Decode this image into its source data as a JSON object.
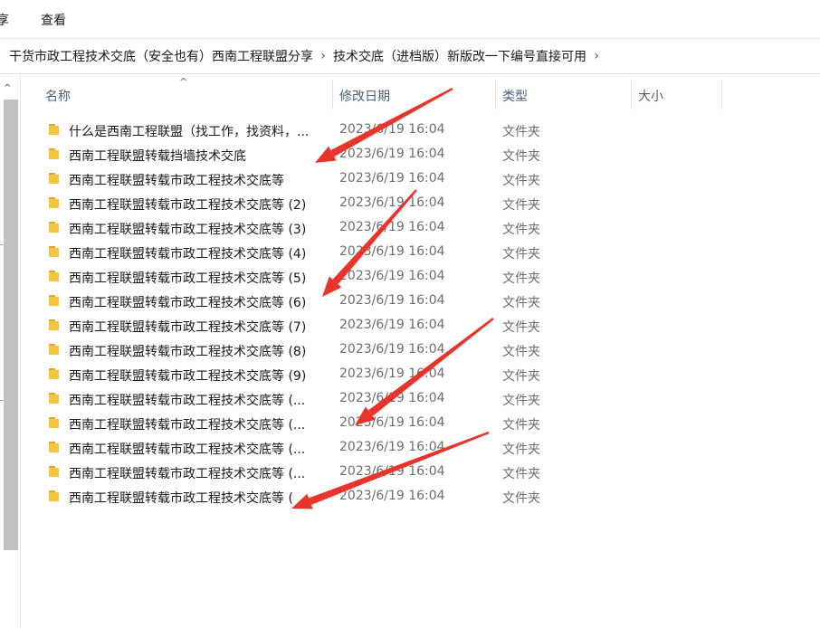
{
  "ribbon": {
    "tab_share": "享",
    "tab_view": "查看"
  },
  "breadcrumb": {
    "segments": [
      "干货市政工程技术交底（安全也有）西南工程联盟分享",
      "技术交底（进档版）新版改一下编号直接可用"
    ]
  },
  "columns": {
    "name": "名称",
    "modified": "修改日期",
    "type": "类型",
    "size": "大小"
  },
  "rows": [
    {
      "name": "什么是西南工程联盟（找工作，找资料，...",
      "modified": "2023/6/19 16:04",
      "type": "文件夹"
    },
    {
      "name": "西南工程联盟转载挡墙技术交底",
      "modified": "2023/6/19 16:04",
      "type": "文件夹"
    },
    {
      "name": "西南工程联盟转载市政工程技术交底等",
      "modified": "2023/6/19 16:04",
      "type": "文件夹"
    },
    {
      "name": "西南工程联盟转载市政工程技术交底等 (2)",
      "modified": "2023/6/19 16:04",
      "type": "文件夹"
    },
    {
      "name": "西南工程联盟转载市政工程技术交底等 (3)",
      "modified": "2023/6/19 16:04",
      "type": "文件夹"
    },
    {
      "name": "西南工程联盟转载市政工程技术交底等 (4)",
      "modified": "2023/6/19 16:04",
      "type": "文件夹"
    },
    {
      "name": "西南工程联盟转载市政工程技术交底等 (5)",
      "modified": "2023/6/19 16:04",
      "type": "文件夹"
    },
    {
      "name": "西南工程联盟转载市政工程技术交底等 (6)",
      "modified": "2023/6/19 16:04",
      "type": "文件夹"
    },
    {
      "name": "西南工程联盟转载市政工程技术交底等 (7)",
      "modified": "2023/6/19 16:04",
      "type": "文件夹"
    },
    {
      "name": "西南工程联盟转载市政工程技术交底等 (8)",
      "modified": "2023/6/19 16:04",
      "type": "文件夹"
    },
    {
      "name": "西南工程联盟转载市政工程技术交底等 (9)",
      "modified": "2023/6/19 16:04",
      "type": "文件夹"
    },
    {
      "name": "西南工程联盟转载市政工程技术交底等 (...",
      "modified": "2023/6/19 16:04",
      "type": "文件夹"
    },
    {
      "name": "西南工程联盟转载市政工程技术交底等 (...",
      "modified": "2023/6/19 16:04",
      "type": "文件夹"
    },
    {
      "name": "西南工程联盟转载市政工程技术交底等 (...",
      "modified": "2023/6/19 16:04",
      "type": "文件夹"
    },
    {
      "name": "西南工程联盟转载市政工程技术交底等 (...",
      "modified": "2023/6/19 16:04",
      "type": "文件夹"
    },
    {
      "name": "西南工程联盟转载市政工程技术交底等 (",
      "modified": "2023/6/19 16:04",
      "type": "文件夹"
    }
  ],
  "colors": {
    "folder": "#f5c542",
    "folder_dark": "#e0a826",
    "annotation_arrow": "#e8342a",
    "header_text": "#4c607a"
  },
  "icons": {
    "folder": "folder-icon",
    "chevron": "chevron-right-icon",
    "sort": "sort-up-icon"
  }
}
